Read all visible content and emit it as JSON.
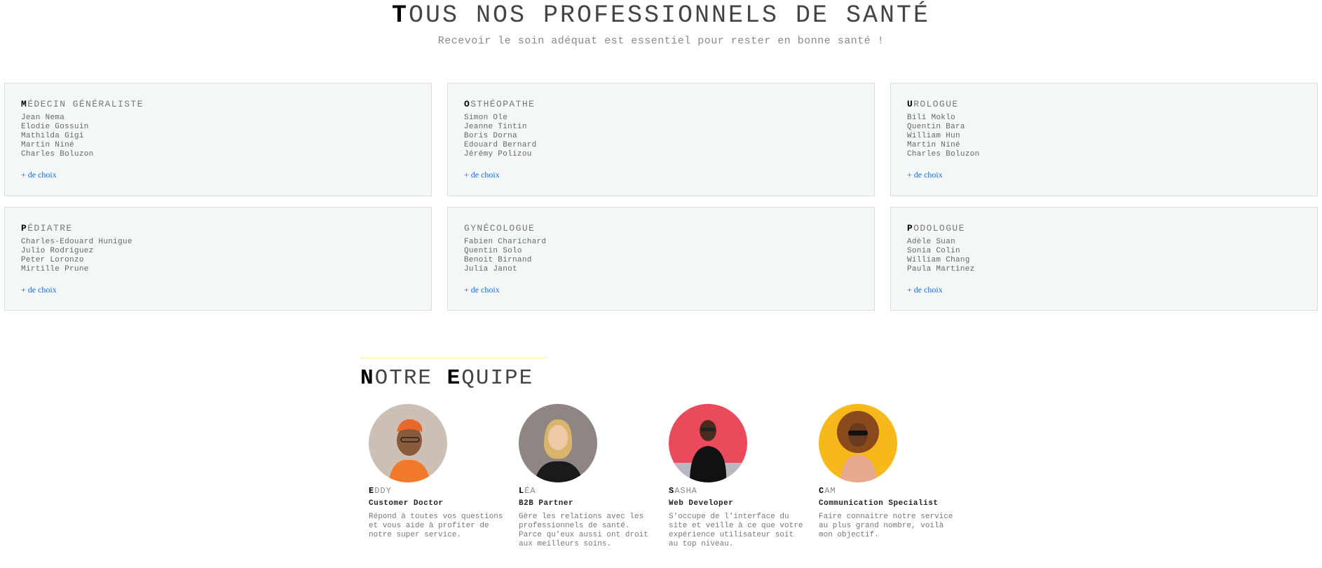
{
  "hero": {
    "title_first": "T",
    "title_rest": "OUS NOS PROFESSIONNELS DE SANTÉ",
    "subtitle": "Recevoir le soin adéquat est essentiel pour rester en bonne santé !"
  },
  "specialties": [
    {
      "first": "M",
      "rest": "ÉDECIN GÉNÉRALISTE",
      "names": [
        "Jean Nema",
        "Elodie Gossuin",
        "Mathilda Gigi",
        "Martin Niné",
        "Charles Boluzon"
      ],
      "link": "+ de choix"
    },
    {
      "first": "O",
      "rest": "STHÉOPATHE",
      "names": [
        "Simon Ole",
        "Jeanne Tintin",
        "Boris Dorna",
        "Edouard Bernard",
        "Jérémy Polizou"
      ],
      "link": "+ de choix"
    },
    {
      "first": "U",
      "rest": "ROLOGUE",
      "names": [
        "Bili Moklo",
        "Quentin Bara",
        "William Hun",
        "Martin Niné",
        "Charles Boluzon"
      ],
      "link": "+ de choix"
    },
    {
      "first": "P",
      "rest": "ÉDIATRE",
      "names": [
        "Charles-Edouard Hunigue",
        "Julio Rodriguez",
        "Peter Loronzo",
        "Mirtille Prune"
      ],
      "link": "+ de choix"
    },
    {
      "first": "G",
      "rest": "YNÉCOLOGUE",
      "names": [
        "Fabien Charichard",
        "Quentin Solo",
        "Benoit Birnand",
        "Julia Janot"
      ],
      "link": "+ de choix"
    },
    {
      "first": "P",
      "rest": "ODOLOGUE",
      "names": [
        "Adèle Suan",
        "Sonia Colin",
        "William Chang",
        "Paula Martinez"
      ],
      "link": "+ de choix"
    }
  ],
  "team": {
    "title_word1_first": "N",
    "title_word1_rest": "OTRE",
    "title_word2_first": "E",
    "title_word2_rest": "QUIPE",
    "members": [
      {
        "first": "E",
        "rest": "DDY",
        "role": "Customer Doctor",
        "desc": "Répond à toutes vos questions et vous aide à profiter de notre super service.",
        "bg": "#cdbfb3",
        "accent": "#f07a2a"
      },
      {
        "first": "L",
        "rest": "ÉA",
        "role": "B2B Partner",
        "desc": "Gère les relations avec les professionnels de santé. Parce qu'eux aussi ont droit aux meilleurs soins.",
        "bg": "#8f8583",
        "accent": "#1a1a1a"
      },
      {
        "first": "S",
        "rest": "ASHA",
        "role": "Web Developer",
        "desc": "S'occupe de l'interface du site et veille à ce que votre expérience utilisateur soit au top niveau.",
        "bg": "#ea4a5c",
        "accent": "#111111"
      },
      {
        "first": "C",
        "rest": "AM",
        "role": "Communication Specialist",
        "desc": "Faire connaitre notre service au plus grand nombre, voilà mon objectif.",
        "bg": "#f7b81c",
        "accent": "#e9a98f"
      }
    ]
  }
}
